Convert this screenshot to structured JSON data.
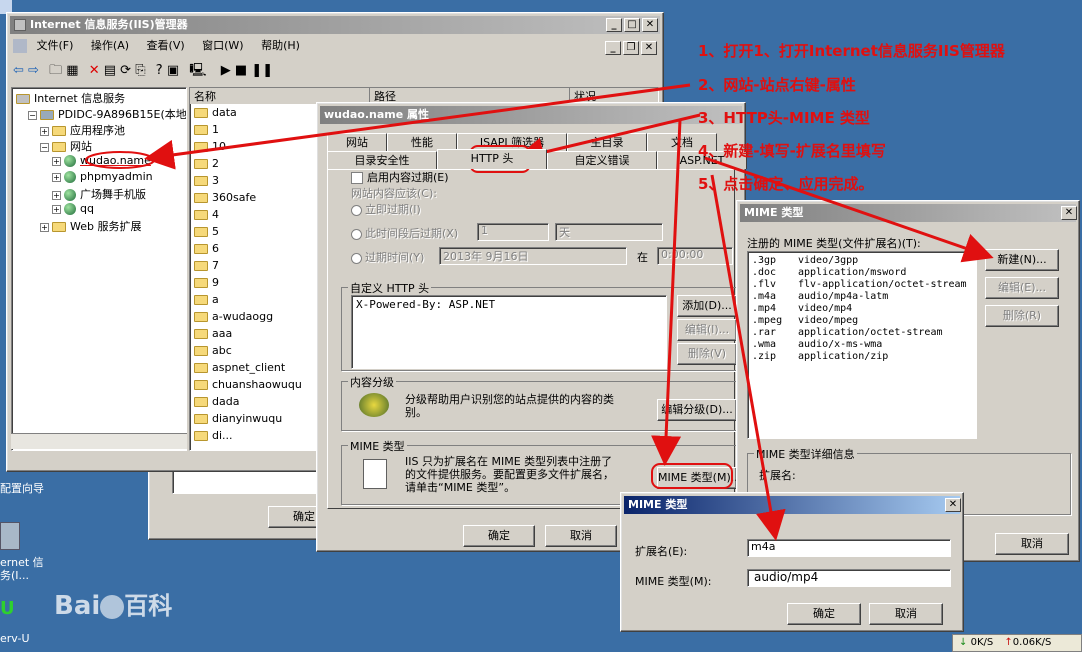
{
  "desktop": {
    "label1": "配置向导",
    "label2": "ernet 信\n务(I...",
    "label3": "erv-U",
    "baidu": "Bai",
    "baidu2": "百科"
  },
  "iis": {
    "title": "Internet 信息服务(IIS)管理器",
    "menu": [
      "文件(F)",
      "操作(A)",
      "查看(V)",
      "窗口(W)",
      "帮助(H)"
    ],
    "tree": [
      {
        "t": "Internet 信息服务",
        "i": "none",
        "d": 0
      },
      {
        "t": "PDIDC-9A896B15E(本地计",
        "i": "pc",
        "d": 1
      },
      {
        "t": "应用程序池",
        "i": "fold",
        "d": 2
      },
      {
        "t": "网站",
        "i": "fold",
        "d": 2
      },
      {
        "t": "wudao.name",
        "i": "globe",
        "d": 3
      },
      {
        "t": "phpmyadmin",
        "i": "globe",
        "d": 3
      },
      {
        "t": "广场舞手机版",
        "i": "globe",
        "d": 3
      },
      {
        "t": "qq",
        "i": "globe",
        "d": 3
      },
      {
        "t": "Web 服务扩展",
        "i": "fold",
        "d": 2
      }
    ],
    "col_name": "名称",
    "col_path": "路径",
    "col_status": "状况",
    "files": [
      "data",
      "1",
      "10",
      "2",
      "3",
      "360safe",
      "4",
      "5",
      "6",
      "7",
      "9",
      "a",
      "a-wudaogg",
      "aaa",
      "abc",
      "aspnet_client",
      "chuanshaowuqu",
      "dada",
      "dianyinwuqu",
      "di..."
    ]
  },
  "props": {
    "title": "wudao.name 属性",
    "tabs_back": [
      "网站",
      "性能",
      "ISAPI 筛选器",
      "主目录",
      "文档"
    ],
    "tabs_front": [
      "目录安全性",
      "HTTP 头",
      "自定义错误",
      "ASP.NET"
    ],
    "expire_check": "启用内容过期(E)",
    "expire_label": "网站内容应该(C):",
    "r1": "立即过期(I)",
    "r2": "此时间段后过期(X)",
    "r2_val": "1",
    "r2_unit": "天",
    "r3": "过期时间(Y)",
    "r3_date": "2013年 9月16日",
    "r3_at": "在",
    "r3_time": "0:00:00",
    "custom_hdr": "自定义 HTTP 头",
    "hdr_value": "X-Powered-By: ASP.NET",
    "add": "添加(D)...",
    "edit": "编辑(I)...",
    "del": "删除(V)",
    "rating_grp": "内容分级",
    "rating_text": "分级帮助用户识别您的站点提供的内容的类别。",
    "rating_btn": "编辑分级(D)...",
    "mime_grp": "MIME 类型",
    "mime_text": "IIS 只为扩展名在 MIME 类型列表中注册了的文件提供服务。要配置更多文件扩展名，请单击“MIME 类型”。",
    "mime_btn": "MIME 类型(M)...",
    "ok": "确定",
    "cancel": "取消",
    "ok2": "确定"
  },
  "mime_list": {
    "title": "MIME 类型",
    "registered": "注册的 MIME 类型(文件扩展名)(T):",
    "items": [
      {
        "ext": ".3gp",
        "type": "video/3gpp"
      },
      {
        "ext": ".doc",
        "type": "application/msword"
      },
      {
        "ext": ".flv",
        "type": "flv-application/octet-stream"
      },
      {
        "ext": ".m4a",
        "type": "audio/mp4a-latm"
      },
      {
        "ext": ".mp4",
        "type": "video/mp4"
      },
      {
        "ext": ".mpeg",
        "type": "video/mpeg"
      },
      {
        "ext": ".rar",
        "type": "application/octet-stream"
      },
      {
        "ext": ".wma",
        "type": "audio/x-ms-wma"
      },
      {
        "ext": ".zip",
        "type": "application/zip"
      }
    ],
    "new": "新建(N)...",
    "edit": "编辑(E)...",
    "del": "删除(R)",
    "detail": "MIME 类型详细信息",
    "ext_lbl": "扩展名:",
    "cancel": "取消"
  },
  "mime_new": {
    "title": "MIME 类型",
    "ext_lbl": "扩展名(E):",
    "ext_val": "m4a",
    "type_lbl": "MIME 类型(M):",
    "type_val": "audio/mp4",
    "ok": "确定",
    "cancel": "取消"
  },
  "steps": [
    "1、打开1、打开Internet信息服务IIS管理器",
    "2、网站-站点右键-属性",
    "3、HTTP头-MIME 类型",
    "4、新建-填写-扩展名里填写",
    "5、点击确定、应用完成。"
  ],
  "tray": {
    "down": "0K/S",
    "up": "0.06K/S"
  },
  "colors": {
    "accent": "#e01010",
    "title": "#0a246a"
  }
}
